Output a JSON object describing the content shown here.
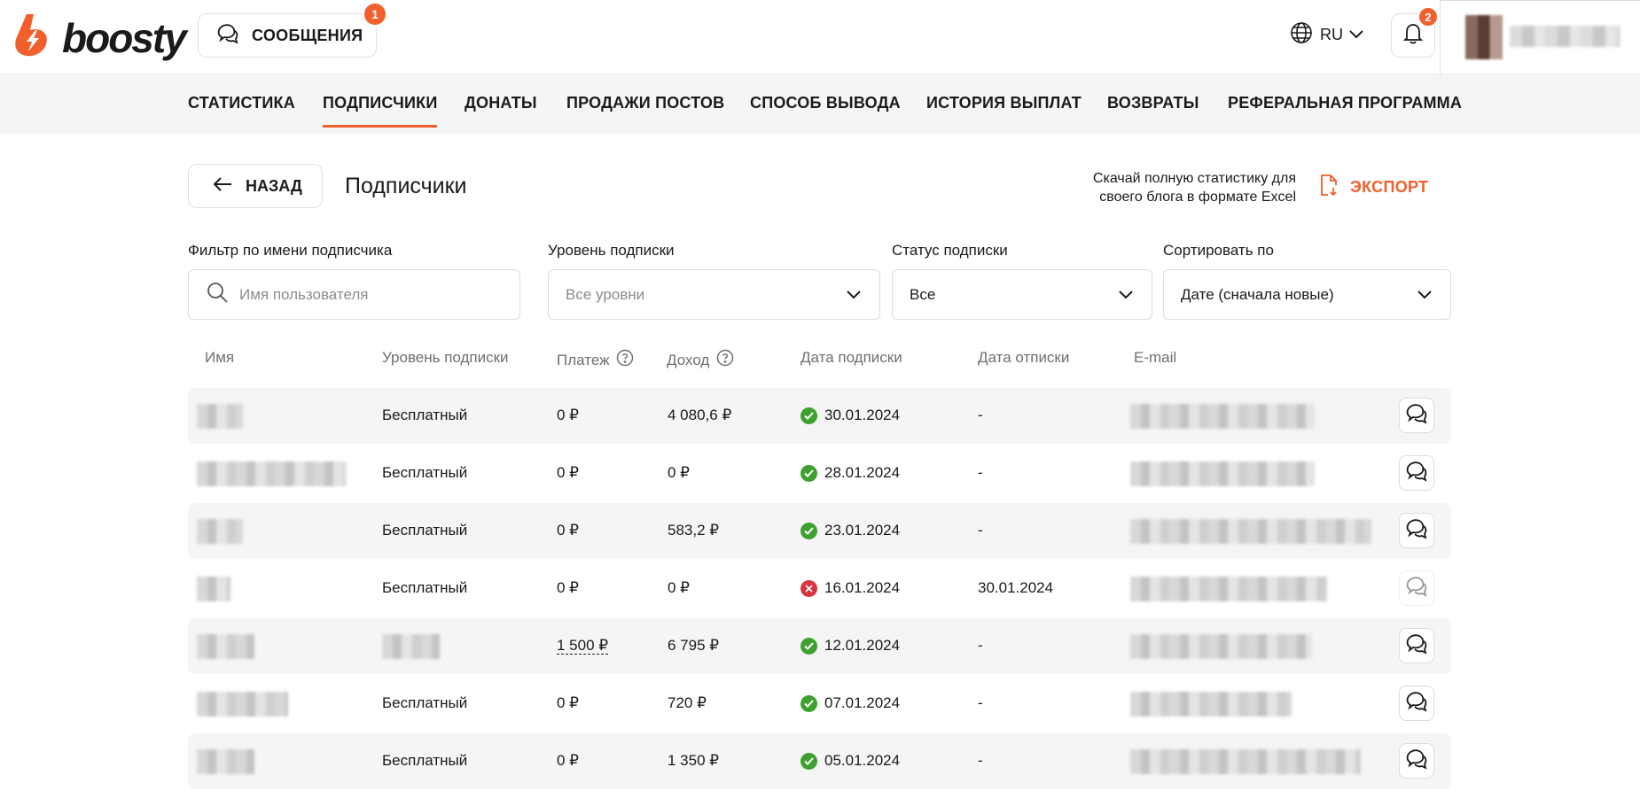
{
  "header": {
    "logo_text": "boosty",
    "messages_label": "СООБЩЕНИЯ",
    "messages_badge": "1",
    "language": "RU",
    "notifications_badge": "2"
  },
  "nav": {
    "items": [
      {
        "label": "СТАТИСТИКА"
      },
      {
        "label": "ПОДПИСЧИКИ",
        "active": true
      },
      {
        "label": "ДОНАТЫ"
      },
      {
        "label": "ПРОДАЖИ ПОСТОВ"
      },
      {
        "label": "СПОСОБ ВЫВОДА"
      },
      {
        "label": "ИСТОРИЯ ВЫПЛАТ"
      },
      {
        "label": "ВОЗВРАТЫ"
      },
      {
        "label": "РЕФЕРАЛЬНАЯ ПРОГРАММА"
      }
    ]
  },
  "page": {
    "back_label": "НАЗАД",
    "title": "Подписчики",
    "export_hint": "Скачай полную статистику для своего блога в формате Excel",
    "export_label": "ЭКСПОРТ"
  },
  "filters": {
    "name": {
      "label": "Фильтр по имени подписчика",
      "placeholder": "Имя пользователя"
    },
    "level": {
      "label": "Уровень подписки",
      "value": "Все уровни"
    },
    "status": {
      "label": "Статус подписки",
      "value": "Все"
    },
    "sort": {
      "label": "Сортировать по",
      "value": "Дате (сначала новые)"
    }
  },
  "table": {
    "headers": {
      "name": "Имя",
      "level": "Уровень подписки",
      "payment": "Платеж",
      "income": "Доход",
      "sub_date": "Дата подписки",
      "unsub_date": "Дата отписки",
      "email": "E-mail"
    },
    "rows": [
      {
        "level": "Бесплатный",
        "payment": "0 ₽",
        "income": "4 080,6 ₽",
        "status": "active",
        "sub_date": "30.01.2024",
        "unsub_date": "-"
      },
      {
        "level": "Бесплатный",
        "payment": "0 ₽",
        "income": "0 ₽",
        "status": "active",
        "sub_date": "28.01.2024",
        "unsub_date": "-"
      },
      {
        "level": "Бесплатный",
        "payment": "0 ₽",
        "income": "583,2 ₽",
        "status": "active",
        "sub_date": "23.01.2024",
        "unsub_date": "-"
      },
      {
        "level": "Бесплатный",
        "payment": "0 ₽",
        "income": "0 ₽",
        "status": "cancelled",
        "sub_date": "16.01.2024",
        "unsub_date": "30.01.2024"
      },
      {
        "level": "",
        "payment": "1 500 ₽",
        "income": "6 795 ₽",
        "status": "active",
        "sub_date": "12.01.2024",
        "unsub_date": "-"
      },
      {
        "level": "Бесплатный",
        "payment": "0 ₽",
        "income": "720 ₽",
        "status": "active",
        "sub_date": "07.01.2024",
        "unsub_date": "-"
      },
      {
        "level": "Бесплатный",
        "payment": "0 ₽",
        "income": "1 350 ₽",
        "status": "active",
        "sub_date": "05.01.2024",
        "unsub_date": "-"
      }
    ]
  },
  "colors": {
    "accent": "#f15f2c",
    "ok": "#3ea12f",
    "error": "#d8343f"
  }
}
